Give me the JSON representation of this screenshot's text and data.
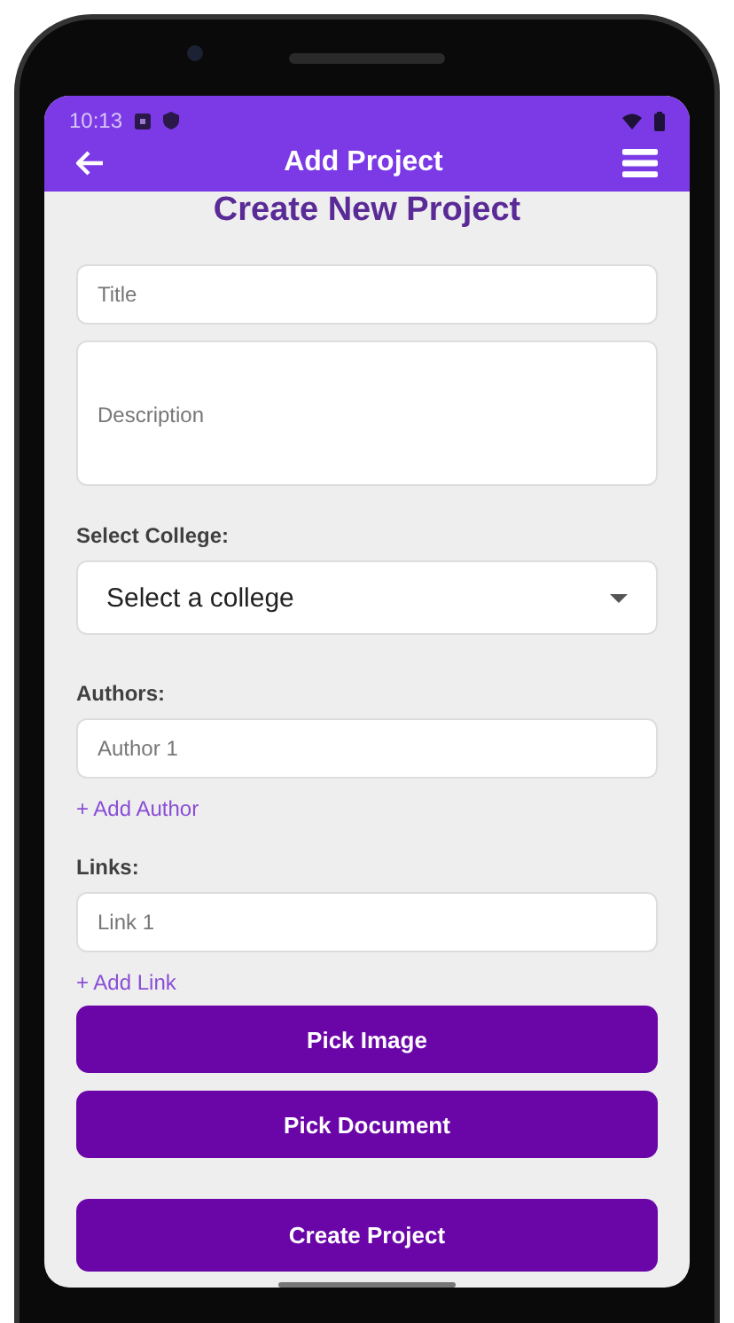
{
  "status_bar": {
    "time": "10:13"
  },
  "app_bar": {
    "title": "Add Project"
  },
  "heading": "Create New Project",
  "fields": [
    {
      "kind": "input",
      "placeholder": "Title"
    },
    {
      "kind": "textarea",
      "placeholder": "Description"
    }
  ],
  "college": {
    "label": "Select College:",
    "value": "Select a college"
  },
  "authors": {
    "label": "Authors:",
    "items": [
      {
        "placeholder": "Author 1"
      }
    ],
    "add_link": "+ Add Author"
  },
  "links": {
    "label": "Links:",
    "items": [
      {
        "placeholder": "Link 1"
      }
    ],
    "add_link": "+ Add Link"
  },
  "buttons": [
    {
      "label": "Pick Image",
      "kind": "secondary"
    },
    {
      "label": "Pick Document",
      "kind": "secondary"
    },
    {
      "label": "Create Project",
      "kind": "primary"
    }
  ]
}
